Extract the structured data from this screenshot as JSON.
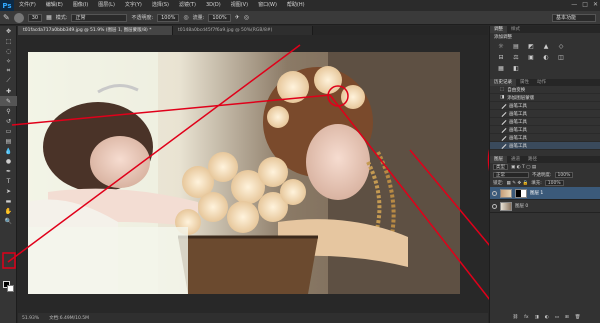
{
  "app": {
    "logo": "Ps"
  },
  "menu": [
    "文件(F)",
    "编辑(E)",
    "图像(I)",
    "图层(L)",
    "文字(Y)",
    "选择(S)",
    "滤镜(T)",
    "3D(D)",
    "视图(V)",
    "窗口(W)",
    "帮助(H)"
  ],
  "window_buttons": [
    "—",
    "□",
    "✕"
  ],
  "options": {
    "brush_size": "30",
    "mode_label": "模式:",
    "mode_value": "正常",
    "opacity_label": "不透明度:",
    "opacity_value": "100%",
    "flow_label": "流量:",
    "flow_value": "100%",
    "workspace": "基本功能"
  },
  "tabs": [
    {
      "label": "t01facda717a0bbb349.jpg @ 51.9% (图层 1, 图层蒙版/8) *"
    },
    {
      "label": "t0148a0bcd45f7f6a9.jpg @ 50%(RGB/8#)"
    }
  ],
  "status": {
    "zoom": "51.93%",
    "doc": "文档:6.49M/10.5M"
  },
  "panels": {
    "top_tabs": [
      "调整",
      "样式"
    ],
    "adjust_title": "添加调整",
    "adjust_icons": [
      "☼",
      "▤",
      "◩",
      "▲",
      "◇",
      "⊟",
      "⚖",
      "▣",
      "◐",
      "◫",
      "▦",
      "◧"
    ],
    "history_tabs": [
      "历史记录",
      "属性",
      "动作"
    ],
    "history": [
      "自由变换",
      "添加图层蒙版",
      "画笔工具",
      "画笔工具",
      "画笔工具",
      "画笔工具",
      "画笔工具",
      "画笔工具"
    ],
    "layers_tabs": [
      "图层",
      "通道",
      "路径"
    ],
    "kind_label": "类型",
    "blend": "正常",
    "opacity_label": "不透明度:",
    "opacity": "100%",
    "lock_label": "锁定:",
    "fill_label": "填充:",
    "fill": "100%",
    "layers": [
      {
        "name": "图层 1"
      },
      {
        "name": "图层 0"
      }
    ]
  },
  "colors": {
    "annotation_red": "#e0001a",
    "selection_blue": "#3b5a7a"
  }
}
